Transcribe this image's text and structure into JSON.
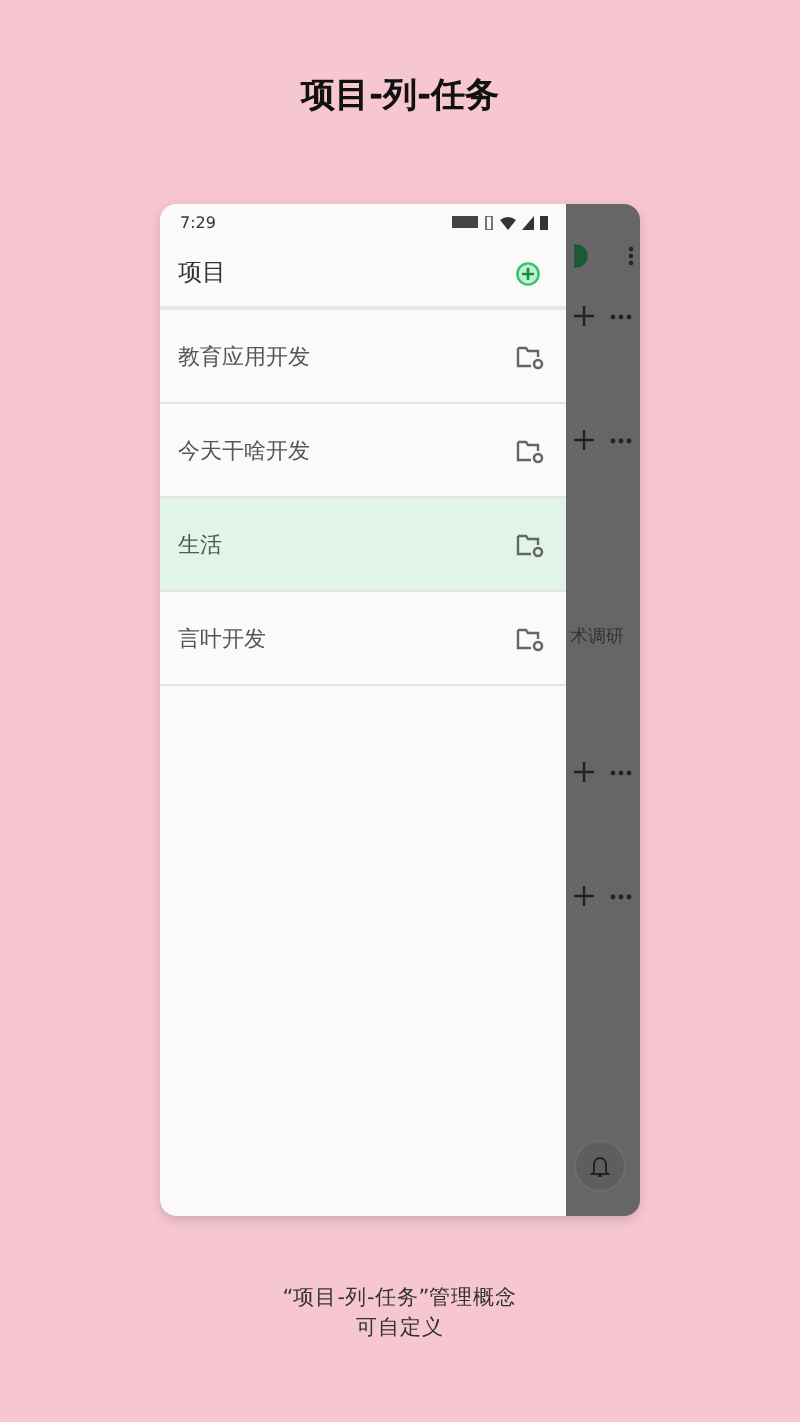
{
  "title": "项目-列-任务",
  "status_bar": {
    "time": "7:29"
  },
  "drawer": {
    "title": "项目",
    "projects": [
      {
        "name": "教育应用开发",
        "selected": false
      },
      {
        "name": "今天干啥开发",
        "selected": false
      },
      {
        "name": "生活",
        "selected": true
      },
      {
        "name": "言叶开发",
        "selected": false
      }
    ]
  },
  "background": {
    "list_rows": [
      {
        "kind": "actions"
      },
      {
        "kind": "actions"
      },
      {
        "kind": "text",
        "text": "术调研"
      },
      {
        "kind": "actions"
      },
      {
        "kind": "actions"
      }
    ]
  },
  "caption": [
    "“项目-列-任务”管理概念",
    "可自定义"
  ]
}
